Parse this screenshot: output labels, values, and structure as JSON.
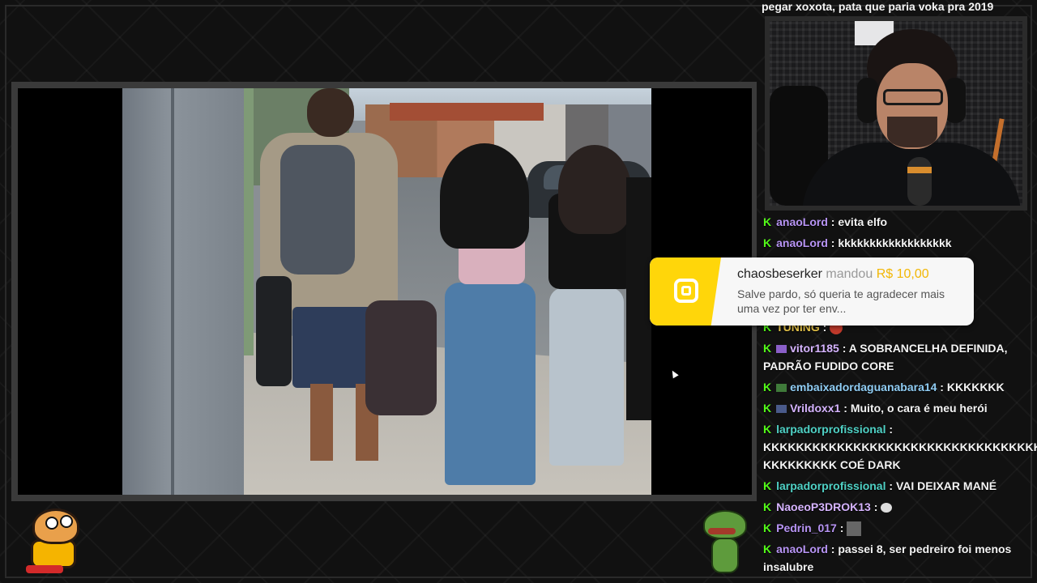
{
  "chat": {
    "top_partial": "pegar xoxota, pata que paria voka pra 2019",
    "messages": [
      {
        "user": "anaoLord",
        "text": "evita elfo",
        "color": "name-purple",
        "badge": ""
      },
      {
        "user": "anaoLord",
        "text": "kkkkkkkkkkkkkkkkkk",
        "color": "name-purple",
        "badge": ""
      },
      {
        "user": "TUNING",
        "text": "",
        "color": "name-gold",
        "badge": "",
        "emote": "fire-emote"
      },
      {
        "user": "vitor1185",
        "text": "A SOBRANCELHA DEFINIDA, PADRÃO FUDIDO CORE",
        "color": "name-lilac",
        "badge": "sub-badge"
      },
      {
        "user": "embaixadordaguanabara14",
        "text": "KKKKKKK",
        "color": "name-blue",
        "badge": "sub-badge"
      },
      {
        "user": "Vrildoxx1",
        "text": "Muito, o cara é meu herói",
        "color": "name-lilac",
        "badge": "sub-badge"
      },
      {
        "user": "larpadorprofissional",
        "text": "KKKKKKKKKKKKKKKKKKKKKKKKKKKKKKKKKKKK KKKKKKKKK COÉ DARK",
        "color": "name-teal",
        "badge": ""
      },
      {
        "user": "larpadorprofissional",
        "text": "VAI DEIXAR MANÉ",
        "color": "name-teal",
        "badge": ""
      },
      {
        "user": "NaoeoP3DROK13",
        "text": "",
        "color": "name-lilac",
        "badge": "",
        "emote": "speech-emote"
      },
      {
        "user": "Pedrin_017",
        "text": "",
        "color": "name-purple",
        "badge": "",
        "emote": "image-emote"
      },
      {
        "user": "anaoLord",
        "text": "passei 8, ser pedreiro foi menos insalubre",
        "color": "name-purple",
        "badge": ""
      }
    ]
  },
  "alert": {
    "donor": "chaosbeserker",
    "verb": "mandou",
    "amount": "R$ 10,00",
    "message": "Salve pardo, só queria te agradecer mais uma vez por ter env..."
  },
  "colors": {
    "kick_green": "#53fc18",
    "alert_yellow": "#ffd60a",
    "background": "#121212"
  }
}
